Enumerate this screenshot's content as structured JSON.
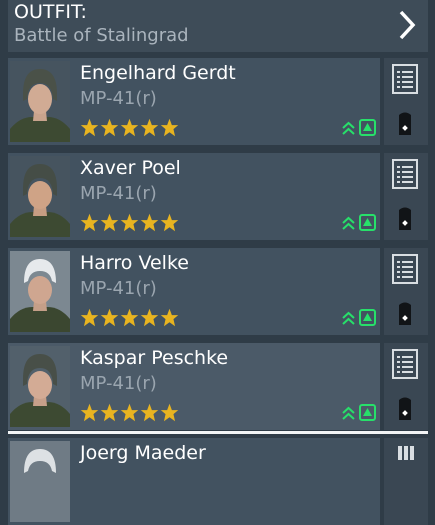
{
  "outfit": {
    "title": "OUTFIT:",
    "name": "Battle of Stalingrad"
  },
  "soldiers": [
    {
      "name": "Engelhard Gerdt",
      "weapon": "MP-41(r)",
      "stars": 5
    },
    {
      "name": "Xaver Poel",
      "weapon": "MP-41(r)",
      "stars": 5
    },
    {
      "name": "Harro Velke",
      "weapon": "MP-41(r)",
      "stars": 5
    },
    {
      "name": "Kaspar Peschke",
      "weapon": "MP-41(r)",
      "stars": 5
    },
    {
      "name": "Joerg Maeder",
      "weapon": "",
      "stars": 0
    }
  ],
  "colors": {
    "star": "#e8b420",
    "upgrade": "#27e06a",
    "panel": "#425260",
    "background": "#2f3c47"
  },
  "icons": {
    "outfit_next": "chevron-right-icon",
    "stats": "list-icon",
    "rank": "rank-insignia-icon",
    "upgrade": "double-chevron-up-icon",
    "upgrade_box": "upgrade-box-icon",
    "star": "star-icon"
  }
}
